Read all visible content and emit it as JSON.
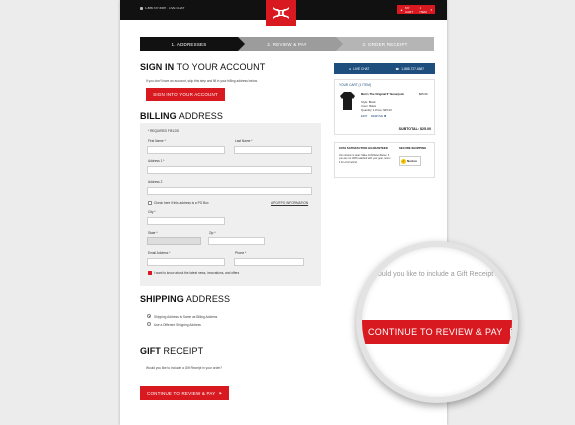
{
  "header": {
    "phone_line": "1-888-727-6687 · LIVE CHAT",
    "cart_label": "MY CART",
    "cart_count": "1 ITEM"
  },
  "steps": [
    "1. ADDRESSES",
    "2. REVIEW & PAY",
    "3. ORDER RECEIPT"
  ],
  "sign_in": {
    "heading_bold": "SIGN IN",
    "heading_rest": " TO YOUR ACCOUNT",
    "note": "If you don't have an account, skip this step and fill in your billing address below.",
    "button": "SIGN INTO YOUR ACCOUNT"
  },
  "billing": {
    "heading_bold": "BILLING",
    "heading_rest": " ADDRESS",
    "required_note": "* REQUIRED FIELDS",
    "first_name": "First Name *",
    "last_name": "Last Name *",
    "address1": "Address 1 *",
    "address2": "Address 2",
    "po_box": "Check here if this address is a PO Box",
    "apo_link": "APO/FPO INFORMATION",
    "city": "City *",
    "state": "State *",
    "zip": "Zip *",
    "email": "Email Address *",
    "phone": "Phone *",
    "newsletter": "I want to know about the latest news, innovations, and offers"
  },
  "shipping": {
    "heading_bold": "SHIPPING",
    "heading_rest": " ADDRESS",
    "option_same": "Shipping Address is Same as Billing Address",
    "option_diff": "Use a Different Shipping Address"
  },
  "gift": {
    "heading_bold": "GIFT",
    "heading_rest": " RECEIPT",
    "question": "Would you like to include a Gift Receipt in your order?"
  },
  "continue_button": "CONTINUE TO REVIEW & PAY",
  "sidebar": {
    "live_chat": "LIVE CHAT",
    "phone": "1-888-727-6687",
    "cart_title": "YOUR CART (1 ITEM)",
    "product_name": "Men's The Original 6\" Boxerjock",
    "product_style": "Style: Black",
    "product_color": "Color: Black",
    "product_qty": "Quantity: 1 Price: $25.00",
    "product_price": "$25.00",
    "edit": "EDIT",
    "remove": "REMOVE",
    "subtotal": "SUBTOTAL:  $25.00",
    "guarantee_title": "100% SATISFACTION GUARANTEED",
    "guarantee_text": "Our mission is clear: Make All Athletes Better. If you are not 100% satisfied with your gear, return it for a full refund.",
    "secure_title": "SECURE SHOPPING",
    "norton": "Norton"
  },
  "magnifier": {
    "text": "ould you like to include a Gift Receipt in yo",
    "button": "CONTINUE TO REVIEW & PAY"
  },
  "colors": {
    "accent": "#d81920",
    "nav_blue": "#1d4e7d",
    "dark": "#111111"
  }
}
